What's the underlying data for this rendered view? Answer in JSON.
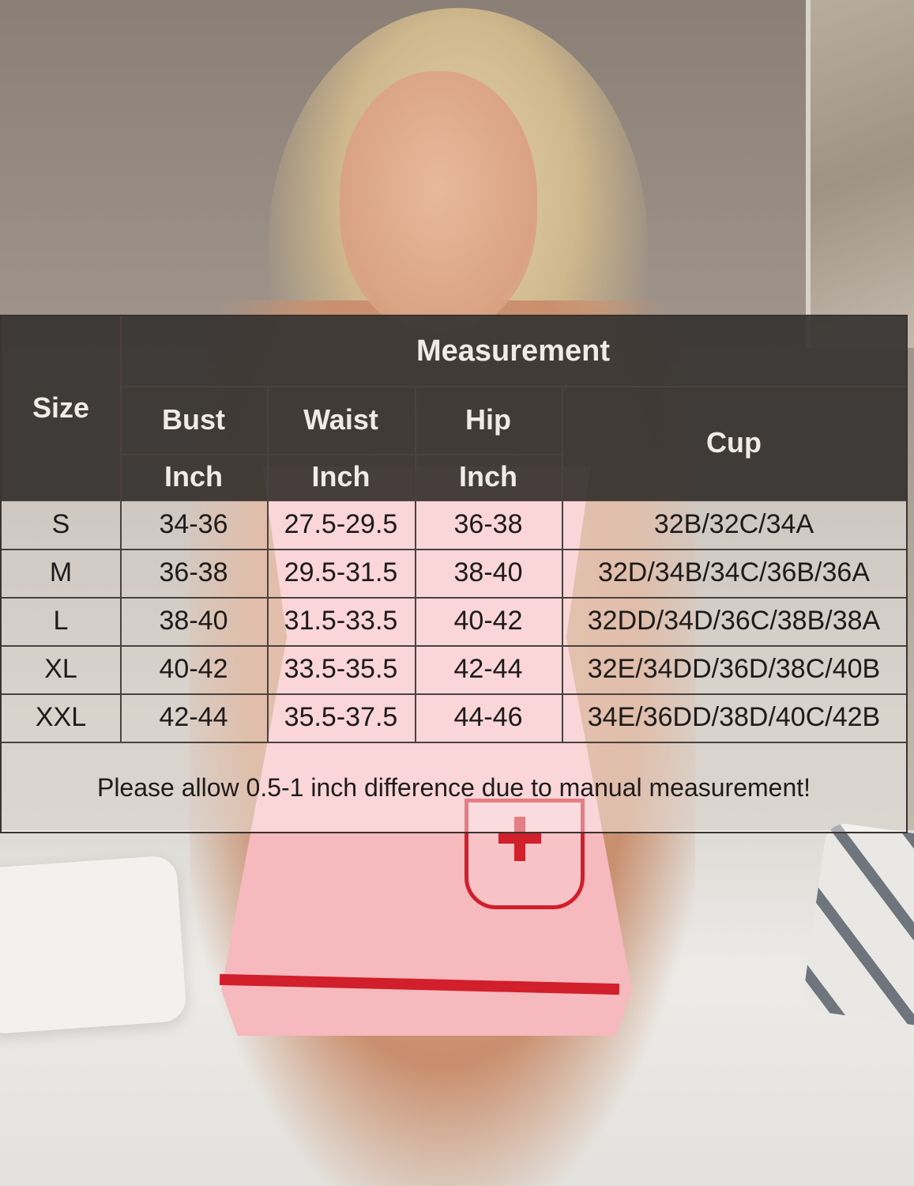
{
  "size_chart": {
    "size_header": "Size",
    "measurement_header": "Measurement",
    "columns": [
      {
        "label": "Bust",
        "unit": "Inch"
      },
      {
        "label": "Waist",
        "unit": "Inch"
      },
      {
        "label": "Hip",
        "unit": "Inch"
      },
      {
        "label": "Cup",
        "unit": ""
      }
    ],
    "rows": [
      {
        "size": "S",
        "bust": "34-36",
        "waist": "27.5-29.5",
        "hip": "36-38",
        "cup": "32B/32C/34A"
      },
      {
        "size": "M",
        "bust": "36-38",
        "waist": "29.5-31.5",
        "hip": "38-40",
        "cup": "32D/34B/34C/36B/36A"
      },
      {
        "size": "L",
        "bust": "38-40",
        "waist": "31.5-33.5",
        "hip": "40-42",
        "cup": "32DD/34D/36C/38B/38A"
      },
      {
        "size": "XL",
        "bust": "40-42",
        "waist": "33.5-35.5",
        "hip": "42-44",
        "cup": "32E/34DD/36D/38C/40B"
      },
      {
        "size": "XXL",
        "bust": "42-44",
        "waist": "35.5-37.5",
        "hip": "44-46",
        "cup": "34E/36DD/38D/40C/42B"
      }
    ],
    "note": "Please allow 0.5-1 inch difference due to manual measurement!"
  },
  "colors": {
    "header_band": "#282422",
    "header_text": "#f1ebe6",
    "dress_pink": "#f6b9bd",
    "accent_red": "#d11f2b"
  }
}
